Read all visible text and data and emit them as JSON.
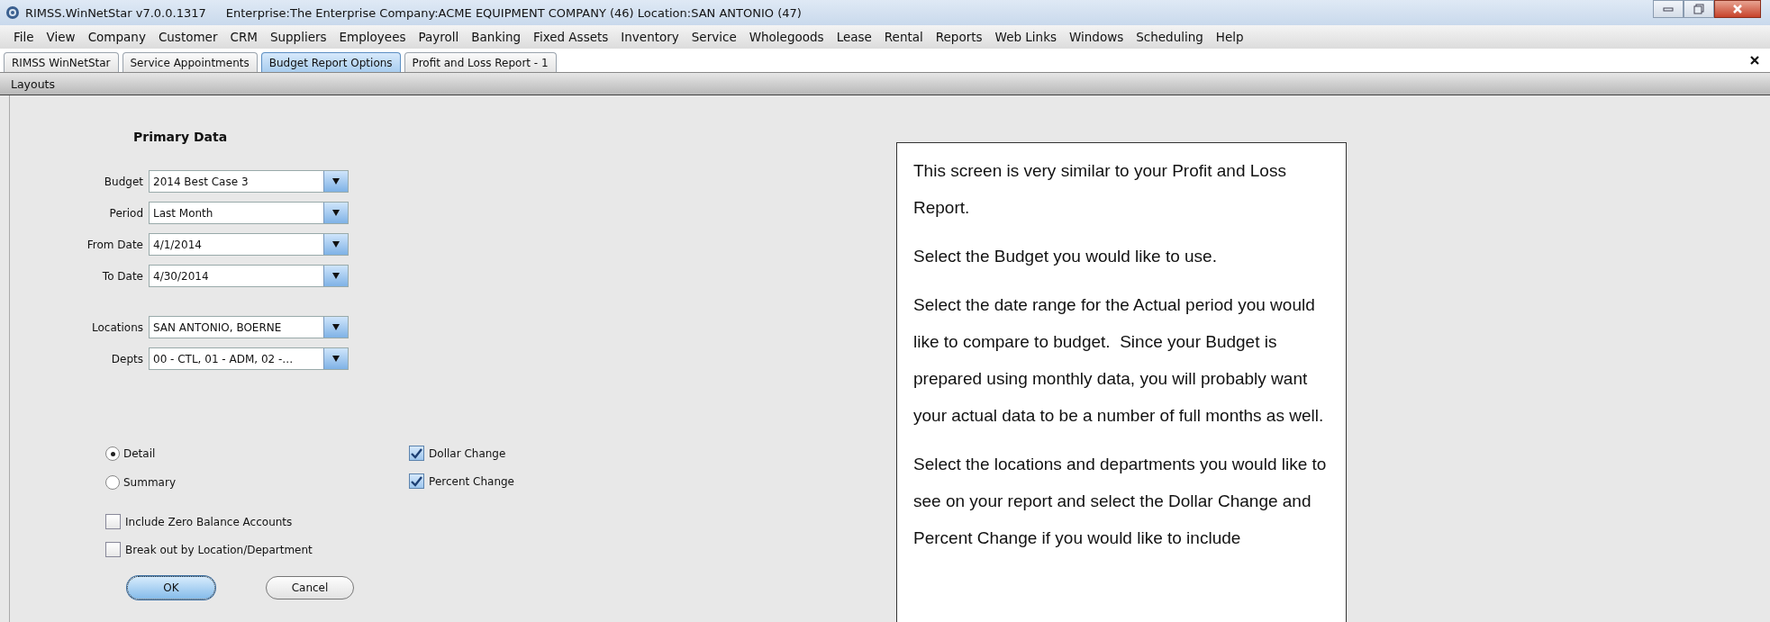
{
  "window": {
    "title": "RIMSS.WinNetStar v7.0.0.1317",
    "context": "Enterprise:The Enterprise  Company:ACME EQUIPMENT COMPANY (46)  Location:SAN ANTONIO (47)"
  },
  "menu": [
    "File",
    "View",
    "Company",
    "Customer",
    "CRM",
    "Suppliers",
    "Employees",
    "Payroll",
    "Banking",
    "Fixed Assets",
    "Inventory",
    "Service",
    "Wholegoods",
    "Lease",
    "Rental",
    "Reports",
    "Web Links",
    "Windows",
    "Scheduling",
    "Help"
  ],
  "tabs": [
    {
      "label": "RIMSS WinNetStar",
      "selected": false
    },
    {
      "label": "Service Appointments",
      "selected": false
    },
    {
      "label": "Budget Report Options",
      "selected": true
    },
    {
      "label": "Profit and Loss Report - 1",
      "selected": false
    }
  ],
  "toolbar": {
    "label": "Layouts"
  },
  "form": {
    "heading": "Primary Data",
    "fields": [
      {
        "label": "Budget",
        "value": "2014 Best Case 3"
      },
      {
        "label": "Period",
        "value": "Last Month"
      },
      {
        "label": "From Date",
        "value": "4/1/2014"
      },
      {
        "label": "To Date",
        "value": "4/30/2014"
      }
    ],
    "filters": [
      {
        "label": "Locations",
        "value": "SAN ANTONIO, BOERNE"
      },
      {
        "label": "Depts",
        "value": "00 - CTL, 01 - ADM, 02 -…"
      }
    ],
    "radios": [
      {
        "label": "Detail",
        "selected": true
      },
      {
        "label": "Summary",
        "selected": false
      }
    ],
    "options": [
      {
        "label": "Include Zero Balance Accounts",
        "checked": false
      },
      {
        "label": "Break out by Location/Department",
        "checked": false
      }
    ],
    "changes": [
      {
        "label": "Dollar Change",
        "checked": true
      },
      {
        "label": "Percent Change",
        "checked": true
      }
    ],
    "buttons": [
      {
        "label": "OK",
        "kind": "default"
      },
      {
        "label": "Cancel",
        "kind": "normal"
      }
    ]
  },
  "note": {
    "paragraphs": [
      "This screen is very similar to your Profit and Loss Report.",
      "Select the Budget you would like to use.",
      "Select the date range for the Actual period you would like to compare to budget.  Since your Budget is prepared using monthly data, you will probably want your actual data to be a number of full months as well.",
      "Select the locations and departments you would like to see on your report and select the Dollar Change and Percent Change if you would like to include"
    ]
  }
}
